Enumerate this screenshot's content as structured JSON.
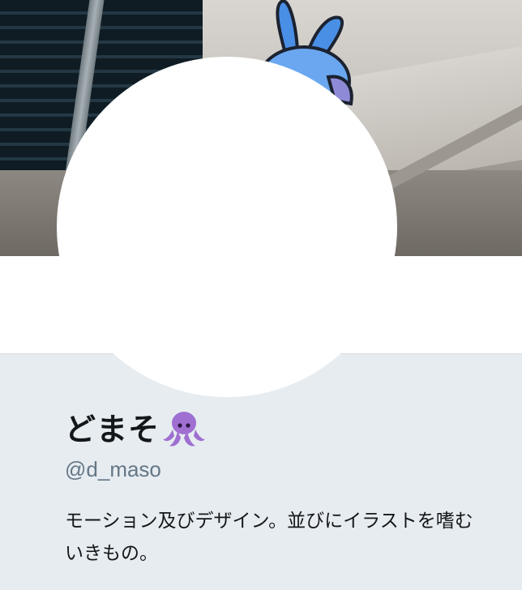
{
  "profile": {
    "display_name": "どまそ",
    "display_name_emoji": "octopus-icon",
    "handle": "@d_maso",
    "bio": "モーション及びデザイン。並びにイラストを嗜むいきもの。"
  },
  "colors": {
    "page_background": "#e6ecf0",
    "name_text": "#14171a",
    "handle_text": "#657786",
    "octopus": "#9f6fd1"
  }
}
